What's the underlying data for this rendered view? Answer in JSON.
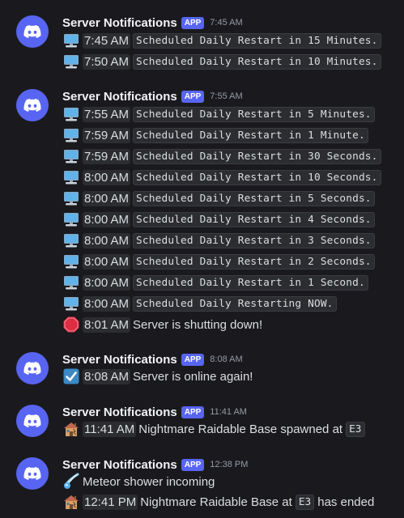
{
  "messages": [
    {
      "author": "Server Notifications",
      "badge": "APP",
      "time": "7:45 AM",
      "lines": [
        {
          "icon": "computer-icon",
          "stamp": "7:45 AM",
          "code": "Scheduled Daily Restart in 15 Minutes."
        },
        {
          "icon": "computer-icon",
          "stamp": "7:50 AM",
          "code": "Scheduled Daily Restart in 10 Minutes."
        }
      ]
    },
    {
      "author": "Server Notifications",
      "badge": "APP",
      "time": "7:55 AM",
      "lines": [
        {
          "icon": "computer-icon",
          "stamp": "7:55 AM",
          "code": "Scheduled Daily Restart in 5 Minutes."
        },
        {
          "icon": "computer-icon",
          "stamp": "7:59 AM",
          "code": "Scheduled Daily Restart in 1 Minute."
        },
        {
          "icon": "computer-icon",
          "stamp": "7:59 AM",
          "code": "Scheduled Daily Restart in 30 Seconds."
        },
        {
          "icon": "computer-icon",
          "stamp": "8:00 AM",
          "code": "Scheduled Daily Restart in 10 Seconds."
        },
        {
          "icon": "computer-icon",
          "stamp": "8:00 AM",
          "code": "Scheduled Daily Restart in 5 Seconds."
        },
        {
          "icon": "computer-icon",
          "stamp": "8:00 AM",
          "code": "Scheduled Daily Restart in 4 Seconds."
        },
        {
          "icon": "computer-icon",
          "stamp": "8:00 AM",
          "code": "Scheduled Daily Restart in 3 Seconds."
        },
        {
          "icon": "computer-icon",
          "stamp": "8:00 AM",
          "code": "Scheduled Daily Restart in 2 Seconds."
        },
        {
          "icon": "computer-icon",
          "stamp": "8:00 AM",
          "code": "Scheduled Daily Restart in 1 Second."
        },
        {
          "icon": "computer-icon",
          "stamp": "8:00 AM",
          "code": "Scheduled Daily Restarting NOW."
        },
        {
          "icon": "stop-sign-icon",
          "stamp": "8:01 AM",
          "text": "Server is shutting down!"
        }
      ]
    },
    {
      "author": "Server Notifications",
      "badge": "APP",
      "time": "8:08 AM",
      "lines": [
        {
          "icon": "check-mark-icon",
          "stamp": "8:08 AM",
          "text": "Server is online again!"
        }
      ]
    },
    {
      "author": "Server Notifications",
      "badge": "APP",
      "time": "11:41 AM",
      "lines": [
        {
          "icon": "derelict-house-icon",
          "stamp": "11:41 AM",
          "text": "Nightmare Raidable Base spawned at",
          "tail_code": "E3"
        }
      ]
    },
    {
      "author": "Server Notifications",
      "badge": "APP",
      "time": "12:38 PM",
      "lines": [
        {
          "icon": "comet-icon",
          "text": "Meteor shower incoming"
        },
        {
          "icon": "derelict-house-icon",
          "stamp": "12:41 PM",
          "text": "Nightmare Raidable Base at",
          "mid_code": "E3",
          "after_text": "has ended"
        }
      ]
    }
  ],
  "colors": {
    "background": "#1a1a1e",
    "avatar": "#5865f2",
    "badge": "#5865f2",
    "author": "#f2f3f5",
    "muted": "#949ba4",
    "code_bg": "#2b2d31"
  }
}
